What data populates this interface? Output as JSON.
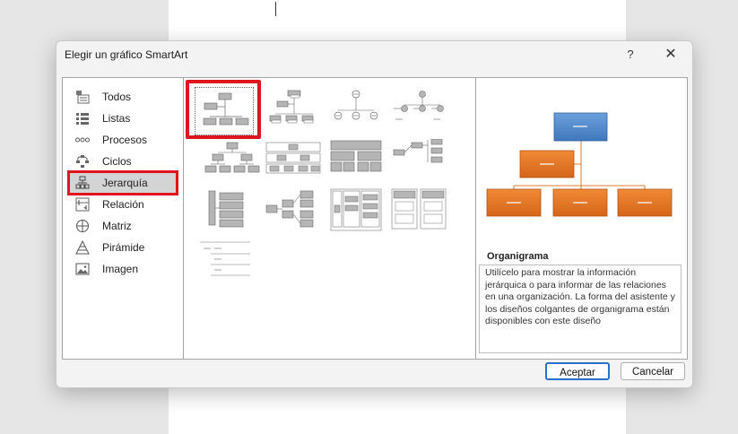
{
  "dialog": {
    "title": "Elegir un gráfico SmartArt",
    "help_label": "?",
    "close_label": "✕"
  },
  "categories": [
    {
      "label": "Todos",
      "icon": "all-icon"
    },
    {
      "label": "Listas",
      "icon": "list-icon"
    },
    {
      "label": "Procesos",
      "icon": "process-icon"
    },
    {
      "label": "Ciclos",
      "icon": "cycle-icon"
    },
    {
      "label": "Jerarquía",
      "icon": "hierarchy-icon",
      "selected": true
    },
    {
      "label": "Relación",
      "icon": "relationship-icon"
    },
    {
      "label": "Matriz",
      "icon": "matrix-icon"
    },
    {
      "label": "Pirámide",
      "icon": "pyramid-icon"
    },
    {
      "label": "Imagen",
      "icon": "picture-icon"
    }
  ],
  "preview": {
    "title": "Organigrama",
    "description": "Utilícelo para mostrar la información jerárquica o para informar de las relaciones en una organización. La forma del asistente y los diseños colgantes de organigrama están disponibles con este diseño"
  },
  "buttons": {
    "ok": "Aceptar",
    "cancel": "Cancelar"
  },
  "colors": {
    "accent_red": "#e0141e",
    "preview_blue": "#4a86c8",
    "preview_orange": "#e0701e",
    "ok_border": "#2a6fc9"
  }
}
